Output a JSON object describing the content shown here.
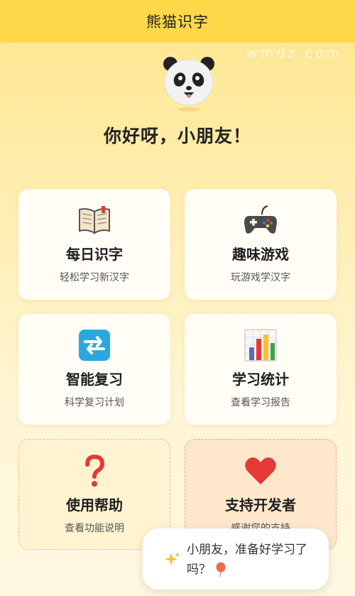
{
  "header": {
    "title": "熊猫识字"
  },
  "watermark": "wmdz.com",
  "greeting": "你好呀，小朋友！",
  "cards": [
    {
      "title": "每日识字",
      "subtitle": "轻松学习新汉字",
      "icon": "book-icon"
    },
    {
      "title": "趣味游戏",
      "subtitle": "玩游戏学汉字",
      "icon": "gamepad-icon"
    },
    {
      "title": "智能复习",
      "subtitle": "科学复习计划",
      "icon": "refresh-icon"
    },
    {
      "title": "学习统计",
      "subtitle": "查看学习报告",
      "icon": "bar-chart-icon"
    },
    {
      "title": "使用帮助",
      "subtitle": "查看功能说明",
      "icon": "question-icon"
    },
    {
      "title": "支持开发者",
      "subtitle": "感谢您的支持",
      "icon": "heart-icon"
    }
  ],
  "bubble": {
    "message": "小朋友，准备好学习了吗？",
    "icons": [
      "sparkle-icon",
      "balloon-icon"
    ]
  },
  "colors": {
    "header": "#FFD84A",
    "accent_red": "#E53935"
  }
}
